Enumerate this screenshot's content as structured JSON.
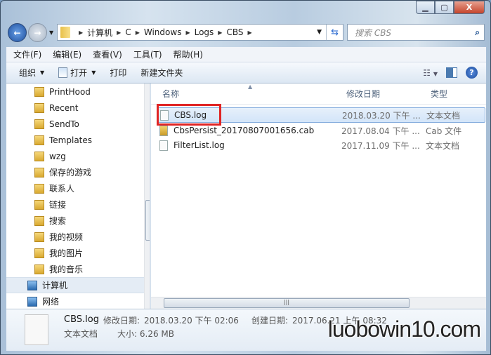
{
  "window": {
    "min": "▁",
    "max": "▢",
    "close": "X"
  },
  "address": {
    "crumbs": [
      "计算机",
      "C",
      "Windows",
      "Logs",
      "CBS"
    ]
  },
  "search": {
    "placeholder": "搜索 CBS",
    "icon": "search-icon"
  },
  "menu": [
    "文件(F)",
    "编辑(E)",
    "查看(V)",
    "工具(T)",
    "帮助(H)"
  ],
  "toolbar": {
    "organize": "组织",
    "open": "打开",
    "print": "打印",
    "new_folder": "新建文件夹",
    "help": "?"
  },
  "sidebar": {
    "items": [
      "PrintHood",
      "Recent",
      "SendTo",
      "Templates",
      "wzg",
      "保存的游戏",
      "联系人",
      "链接",
      "搜索",
      "我的视频",
      "我的图片",
      "我的音乐",
      "计算机",
      "网络"
    ]
  },
  "columns": {
    "name": "名称",
    "date": "修改日期",
    "type": "类型"
  },
  "files": [
    {
      "name": "CBS.log",
      "date": "2018.03.20 下午 ...",
      "type": "文本文档"
    },
    {
      "name": "CbsPersist_20170807001656.cab",
      "date": "2017.08.04 下午 ...",
      "type": "Cab 文件"
    },
    {
      "name": "FilterList.log",
      "date": "2017.11.09 下午 ...",
      "type": "文本文档"
    }
  ],
  "details": {
    "name": "CBS.log",
    "modified_label": "修改日期:",
    "modified": "2018.03.20 下午 02:06",
    "created_label": "创建日期:",
    "created": "2017.06.21 上午 08:32",
    "kind": "文本文档",
    "size_label": "大小:",
    "size": "6.26 MB"
  },
  "watermark": "luobowin10.com"
}
